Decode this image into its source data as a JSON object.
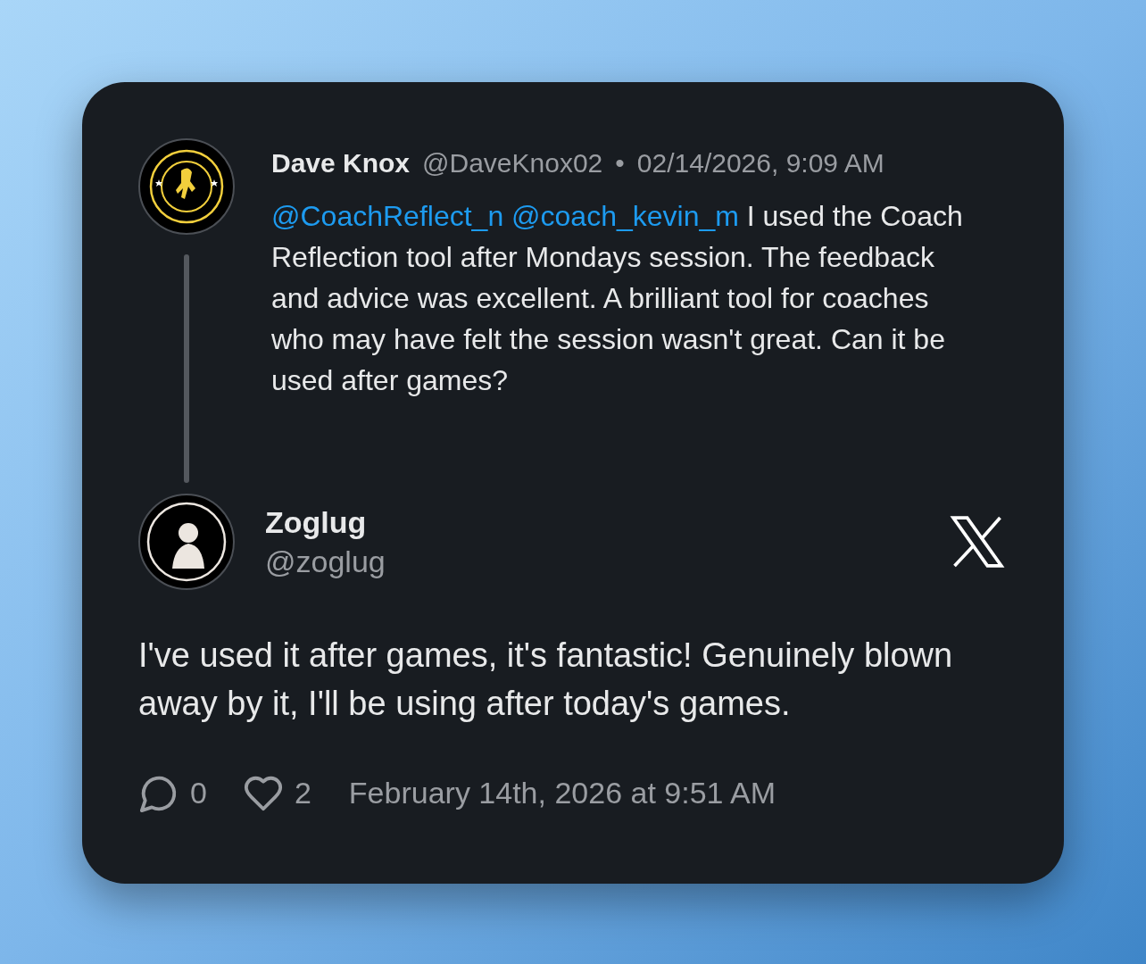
{
  "parent_post": {
    "name": "Dave Knox",
    "handle": "@DaveKnox02",
    "separator": "•",
    "timestamp": "02/14/2026, 9:09 AM",
    "mentions": [
      "@CoachReflect_n",
      "@coach_kevin_m"
    ],
    "text": "I used the Coach Reflection tool after Mondays session. The feedback and advice was excellent. A brilliant tool for coaches who may have felt the session wasn't great. Can it be used after games?"
  },
  "reply": {
    "name": "Zoglug",
    "handle": "@zoglug",
    "text": "I've used it after games, it's fantastic! Genuinely blown away by it, I'll be using after today's games.",
    "replies": "0",
    "likes": "2",
    "timestamp": "February 14th, 2026 at 9:51 AM"
  }
}
